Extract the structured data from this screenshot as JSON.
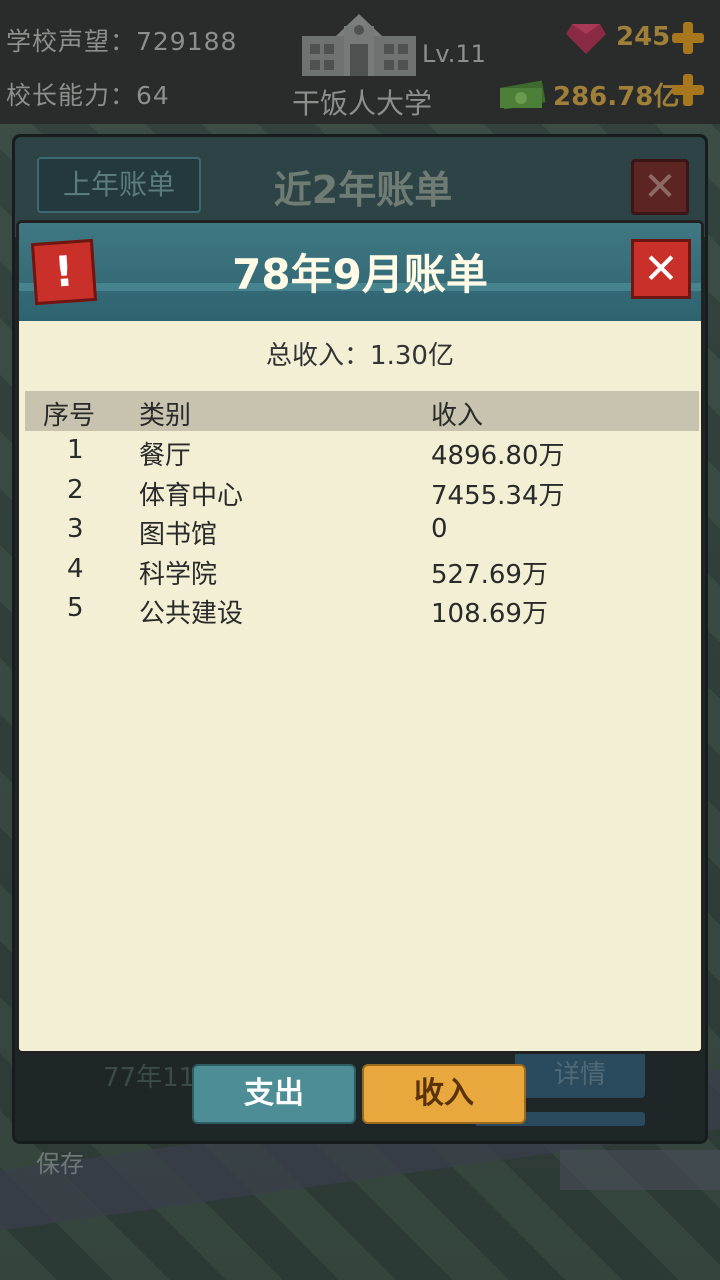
{
  "topbar": {
    "reputation_label": "学校声望：729188",
    "ability_label": "校长能力：64",
    "level": "Lv.11",
    "school_name": "干饭人大学",
    "gems": "245",
    "money": "286.78亿"
  },
  "back_dialog": {
    "last_year_button": "上年账单",
    "title": "近2年账单",
    "row_text": "77年11",
    "detail_button": "详情",
    "save_text": "保存"
  },
  "tabs": {
    "expense": "支出",
    "income": "收入"
  },
  "bill": {
    "title": "78年9月账单",
    "total_income": "总收入：1.30亿",
    "headers": {
      "no": "序号",
      "category": "类别",
      "income": "收入"
    },
    "rows": [
      {
        "no": "1",
        "category": "餐厅",
        "income": "4896.80万"
      },
      {
        "no": "2",
        "category": "体育中心",
        "income": "7455.34万"
      },
      {
        "no": "3",
        "category": "图书馆",
        "income": "0"
      },
      {
        "no": "4",
        "category": "科学院",
        "income": "527.69万"
      },
      {
        "no": "5",
        "category": "公共建设",
        "income": "108.69万"
      }
    ]
  },
  "colors": {
    "accent_gold": "#e8a83e",
    "close_red": "#c9302a",
    "header_teal": "#3f7883",
    "paper": "#f2efd4"
  }
}
